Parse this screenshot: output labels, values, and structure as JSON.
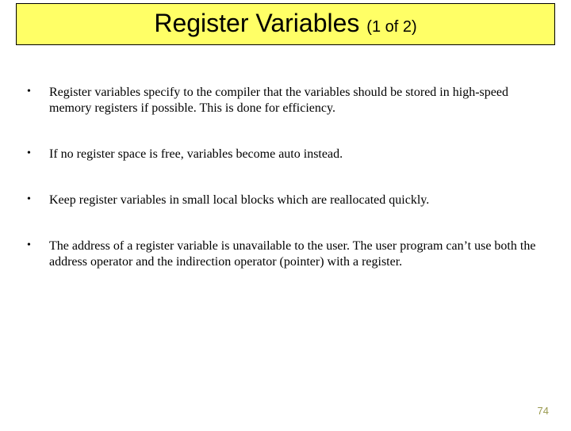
{
  "title": {
    "main": "Register Variables ",
    "sub": "(1 of 2)"
  },
  "bullets": [
    "Register variables specify to the compiler that the variables should be stored in high-speed memory registers if possible. This is done for efficiency.",
    "If no register space is free, variables become auto instead.",
    "Keep register variables in small local blocks which are reallocated quickly.",
    "The address of a register variable is unavailable to the user. The user program can’t use both the address operator and the indirection operator (pointer) with a register."
  ],
  "page_number": "74"
}
